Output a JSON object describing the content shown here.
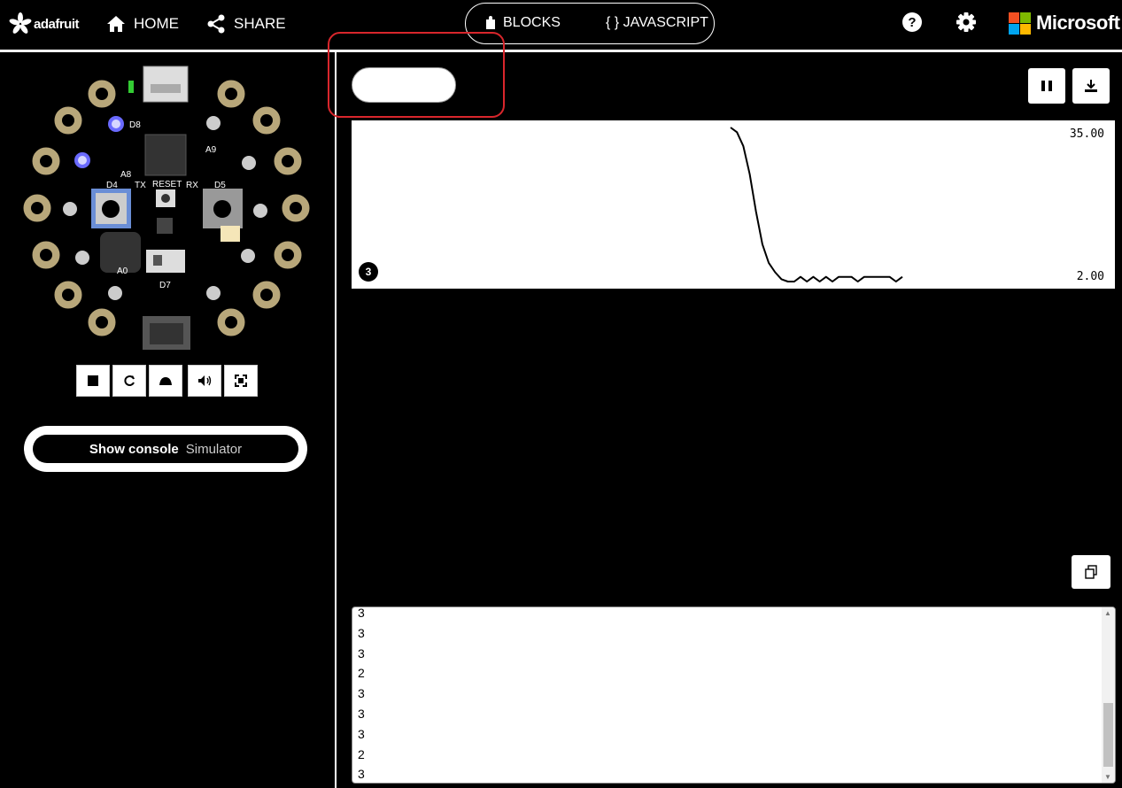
{
  "header": {
    "brand": "adafruit",
    "home_label": "HOME",
    "share_label": "SHARE",
    "blocks_label": "BLOCKS",
    "javascript_label": "{ } JAVASCRIPT",
    "microsoft_label": "Microsoft",
    "microsoft_colors": [
      "#f25022",
      "#7fba00",
      "#00a4ef",
      "#ffb900"
    ]
  },
  "simulator": {
    "console_toggle_bold": "Show console",
    "console_toggle_suffix": "Simulator",
    "toolbar_icons": [
      "stop-icon",
      "restart-icon",
      "slow-motion-icon",
      "mute-icon",
      "fullscreen-icon"
    ]
  },
  "serial": {
    "pause_icon": "pause-icon",
    "download_icon": "download-icon",
    "copy_icon": "copy-icon",
    "series_badge": "3",
    "log_lines": [
      "3",
      "3",
      "3",
      "2",
      "3",
      "3",
      "3",
      "2",
      "3"
    ]
  },
  "chart_data": {
    "type": "line",
    "y_max_label": "35.00",
    "y_min_label": "2.00",
    "ylim": [
      2,
      35
    ],
    "series": [
      {
        "values": [
          35,
          34,
          31,
          25,
          17,
          10,
          6,
          4,
          2.5,
          2,
          2,
          3,
          2,
          3,
          2,
          3,
          2,
          3,
          3,
          3,
          2,
          3,
          3,
          3,
          3,
          3,
          2,
          3
        ]
      }
    ],
    "series_color": "#000000",
    "grid": false
  }
}
